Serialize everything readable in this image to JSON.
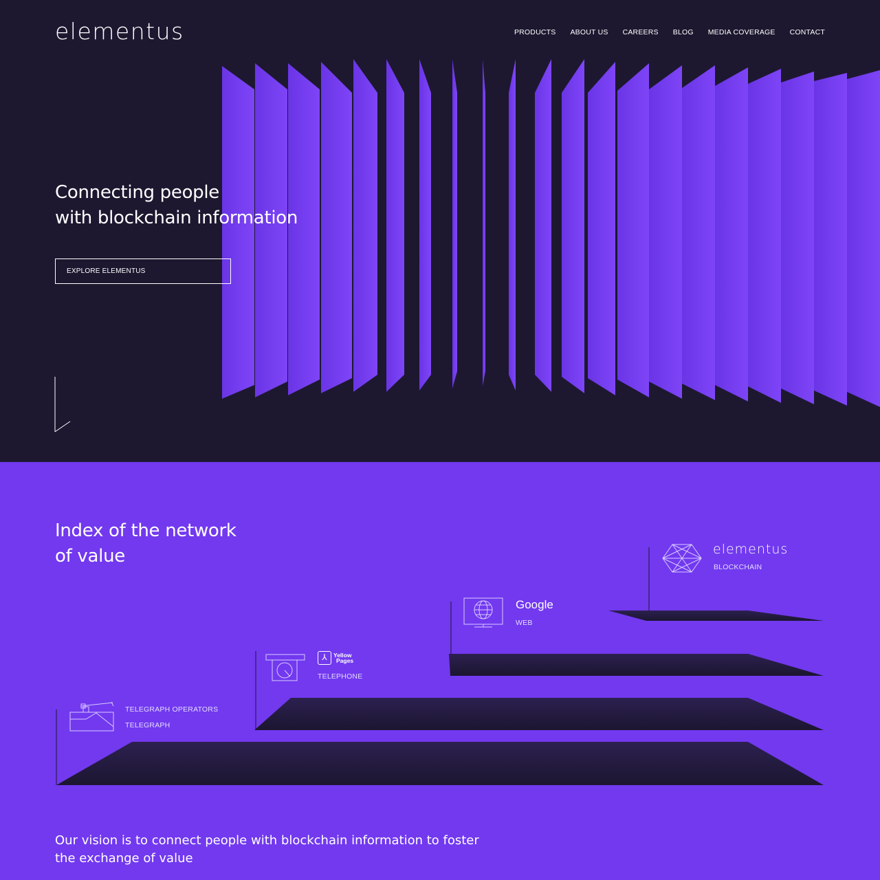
{
  "header": {
    "logo": "elementus",
    "nav": [
      "PRODUCTS",
      "ABOUT US",
      "CAREERS",
      "BLOG",
      "MEDIA COVERAGE",
      "CONTACT"
    ]
  },
  "hero": {
    "title_line1": "Connecting people",
    "title_line2": "with blockchain information",
    "cta_label": "EXPLORE ELEMENTUS"
  },
  "index": {
    "title_line1": "Index of the network",
    "title_line2": "of value",
    "steps": [
      {
        "brand": "TELEGRAPH OPERATORS",
        "category": "TELEGRAPH",
        "icon": "telegraph-key-icon"
      },
      {
        "brand": "Yellow Pages",
        "category": "TELEPHONE",
        "icon": "telephone-icon"
      },
      {
        "brand": "Google",
        "category": "WEB",
        "icon": "computer-monitor-icon"
      },
      {
        "brand": "elementus",
        "category": "BLOCKCHAIN",
        "icon": "network-globe-icon"
      }
    ],
    "yp_line1": "Yellow",
    "yp_line2": "Pages",
    "yp_glyph": "⅄"
  },
  "vision": "Our vision is to connect people with blockchain information to foster the exchange of value",
  "colors": {
    "dark_bg": "#1d1830",
    "accent_purple": "#7239ef",
    "panel_purple": "#7a3ff5",
    "stair_dark": "#241a3a"
  }
}
